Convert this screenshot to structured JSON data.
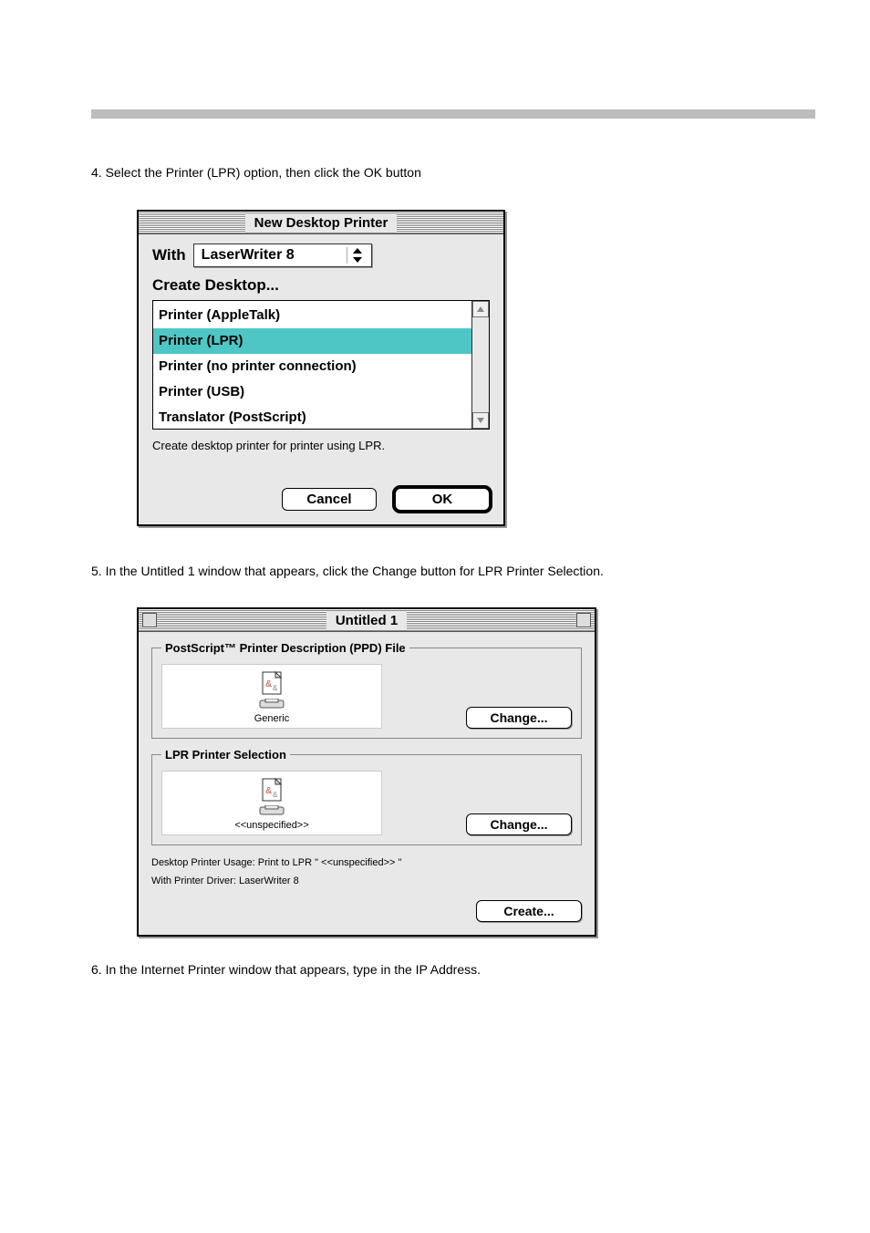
{
  "step1_text": "4. Select the Printer (LPR) option, then click the OK button",
  "dialog1": {
    "title": "New Desktop Printer",
    "with_label": "With",
    "with_value": "LaserWriter 8",
    "create_label": "Create Desktop...",
    "options": [
      "Printer (AppleTalk)",
      "Printer (LPR)",
      "Printer (no printer connection)",
      "Printer (USB)",
      "Translator (PostScript)"
    ],
    "selected_index": 1,
    "hint": "Create desktop printer for printer using LPR.",
    "cancel": "Cancel",
    "ok": "OK"
  },
  "step2_text": "5. In the Untitled 1 window that appears, click the Change button for LPR Printer Selection.",
  "dialog2": {
    "title": "Untitled 1",
    "group1_title": "PostScript™ Printer Description (PPD) File",
    "group1_icon_label": "Generic",
    "group1_button": "Change...",
    "group2_title": "LPR Printer Selection",
    "group2_icon_label": "<<unspecified>>",
    "group2_button": "Change...",
    "usage_line": "Desktop Printer Usage: Print to LPR \" <<unspecified>> \"",
    "driver_line": "With Printer Driver: LaserWriter 8",
    "create_button": "Create..."
  },
  "footer_text": "6. In the Internet Printer window that appears, type in the IP Address."
}
